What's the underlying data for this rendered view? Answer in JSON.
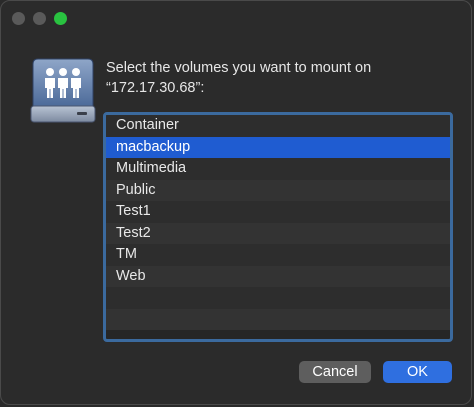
{
  "window": {
    "controls": [
      "close",
      "minimize",
      "zoom"
    ]
  },
  "icon": "network-volume-icon",
  "prompt": {
    "line1": "Select the volumes you want to mount on",
    "line2": "“172.17.30.68”:"
  },
  "volumes": {
    "items": [
      {
        "label": "Container",
        "selected": false
      },
      {
        "label": "macbackup",
        "selected": true
      },
      {
        "label": "Multimedia",
        "selected": false
      },
      {
        "label": "Public",
        "selected": false
      },
      {
        "label": "Test1",
        "selected": false
      },
      {
        "label": "Test2",
        "selected": false
      },
      {
        "label": "TM",
        "selected": false
      },
      {
        "label": "Web",
        "selected": false
      }
    ],
    "empty_rows": 2
  },
  "buttons": {
    "cancel_label": "Cancel",
    "ok_label": "OK"
  },
  "colors": {
    "accent": "#1f5cd1",
    "focus_ring": "#3b6a9e",
    "zoom": "#29c240"
  }
}
